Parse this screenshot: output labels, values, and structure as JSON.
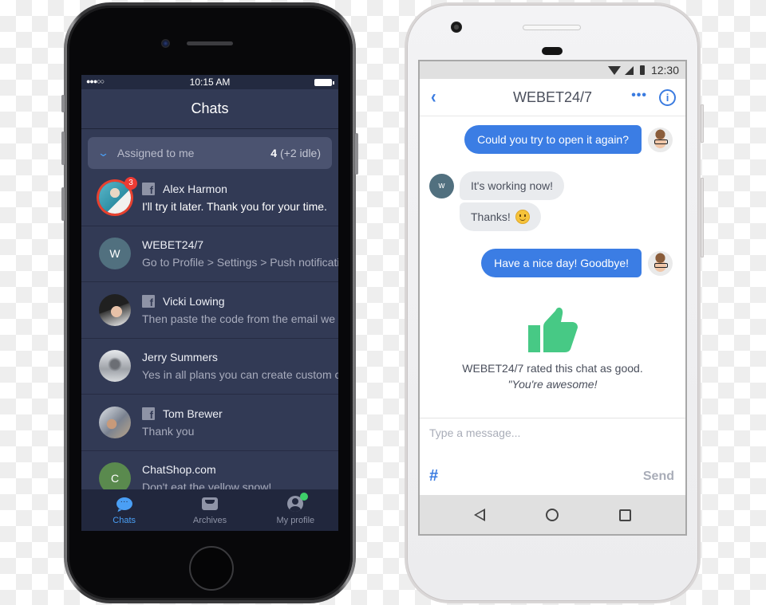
{
  "ios": {
    "status": {
      "signal": "●●●○○",
      "time": "10:15 AM"
    },
    "header": {
      "title": "Chats"
    },
    "group": {
      "label": "Assigned to me",
      "count": "4",
      "idle": "(+2 idle)"
    },
    "chats": [
      {
        "name": "Alex Harmon",
        "message": "I'll try it later. Thank you for your time.",
        "source": "facebook",
        "unread": "3",
        "avatar": "photo"
      },
      {
        "name": "WEBET24/7",
        "message": "Go to Profile > Settings > Push notifications",
        "source": "web",
        "initial": "W",
        "avatar_color": "#51707f"
      },
      {
        "name": "Vicki Lowing",
        "message": "Then paste the code from the email we sent you",
        "source": "facebook",
        "avatar": "photo"
      },
      {
        "name": "Jerry Summers",
        "message": "Yes in all plans you can create custom canned responses",
        "source": "web",
        "avatar": "photo"
      },
      {
        "name": "Tom Brewer",
        "message": "Thank you",
        "source": "facebook",
        "avatar": "photo"
      },
      {
        "name": "ChatShop.com",
        "message": "Don't eat the yellow snow!",
        "source": "web",
        "initial": "C",
        "avatar_color": "#5a8a4e"
      }
    ],
    "tabs": [
      {
        "label": "Chats",
        "icon": "chat-bubble-icon",
        "active": true
      },
      {
        "label": "Archives",
        "icon": "inbox-icon",
        "active": false
      },
      {
        "label": "My profile",
        "icon": "profile-icon",
        "active": false,
        "online": true
      }
    ]
  },
  "android": {
    "status": {
      "time": "12:30"
    },
    "header": {
      "title": "WEBET24/7",
      "back_icon": "‹",
      "more_icon": "•••",
      "info_icon": "i"
    },
    "messages": [
      {
        "from": "agent",
        "text": "Could you try to open it again?"
      },
      {
        "from": "visitor",
        "initial": "w",
        "text": "It's working now!"
      },
      {
        "from": "visitor",
        "text": "Thanks!",
        "emoji": "slightly-smiling-face"
      },
      {
        "from": "agent",
        "text": "Have a nice day! Goodbye!"
      }
    ],
    "rating": {
      "text": "WEBET24/7 rated this chat as good.",
      "comment": "\"You're awesome!",
      "icon": "thumbs-up-icon",
      "color": "#47c985"
    },
    "composer": {
      "placeholder": "Type a message...",
      "value": "",
      "hash_label": "#",
      "send_label": "Send"
    }
  },
  "colors": {
    "accent_blue": "#3b7de4",
    "ios_accent": "#4a9ff5",
    "badge_red": "#ee3b34",
    "online_green": "#3ecf6a"
  }
}
